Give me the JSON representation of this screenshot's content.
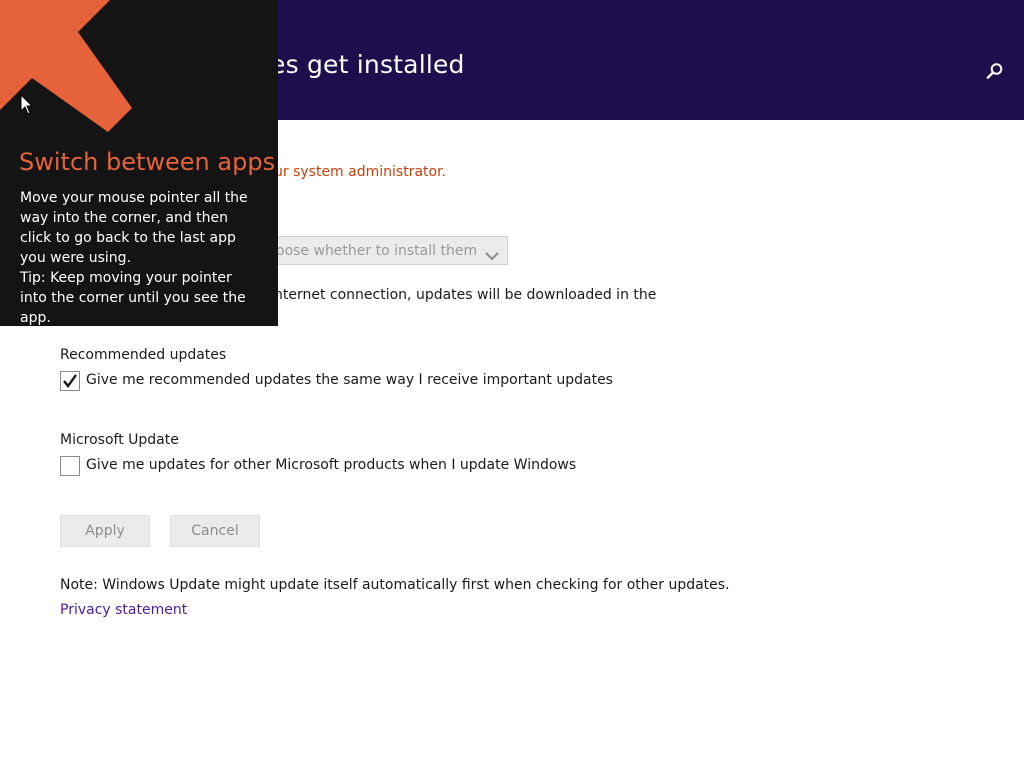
{
  "header": {
    "title": "es get installed",
    "search_icon": "search-icon",
    "background_color": "#1d0e4e"
  },
  "main": {
    "admin_note": "ur system administrator.",
    "admin_note_color": "#c7400c",
    "important_updates_dropdown": {
      "selected_value": "oose whether to install them"
    },
    "description": "nternet connection, updates will be downloaded in the",
    "recommended": {
      "label": "Recommended updates",
      "checkbox_label": "Give me recommended updates the same way I receive important updates",
      "checked": true
    },
    "microsoft_update": {
      "label": "Microsoft Update",
      "checkbox_label": "Give me updates for other Microsoft products when I update Windows",
      "checked": false
    },
    "buttons": {
      "apply_label": "Apply",
      "cancel_label": "Cancel"
    },
    "note": "Note: Windows Update might update itself automatically first when checking for other updates.",
    "privacy_link": "Privacy statement"
  },
  "tip": {
    "title": "Switch between apps",
    "body_line1": "Move your mouse pointer all the way into the corner, and then click to go back to the last app you were using.",
    "body_line2": "Tip: Keep moving your pointer into the corner until you see the app.",
    "accent_color": "#e5623a",
    "arrow_icon": "corner-arrow-icon"
  }
}
